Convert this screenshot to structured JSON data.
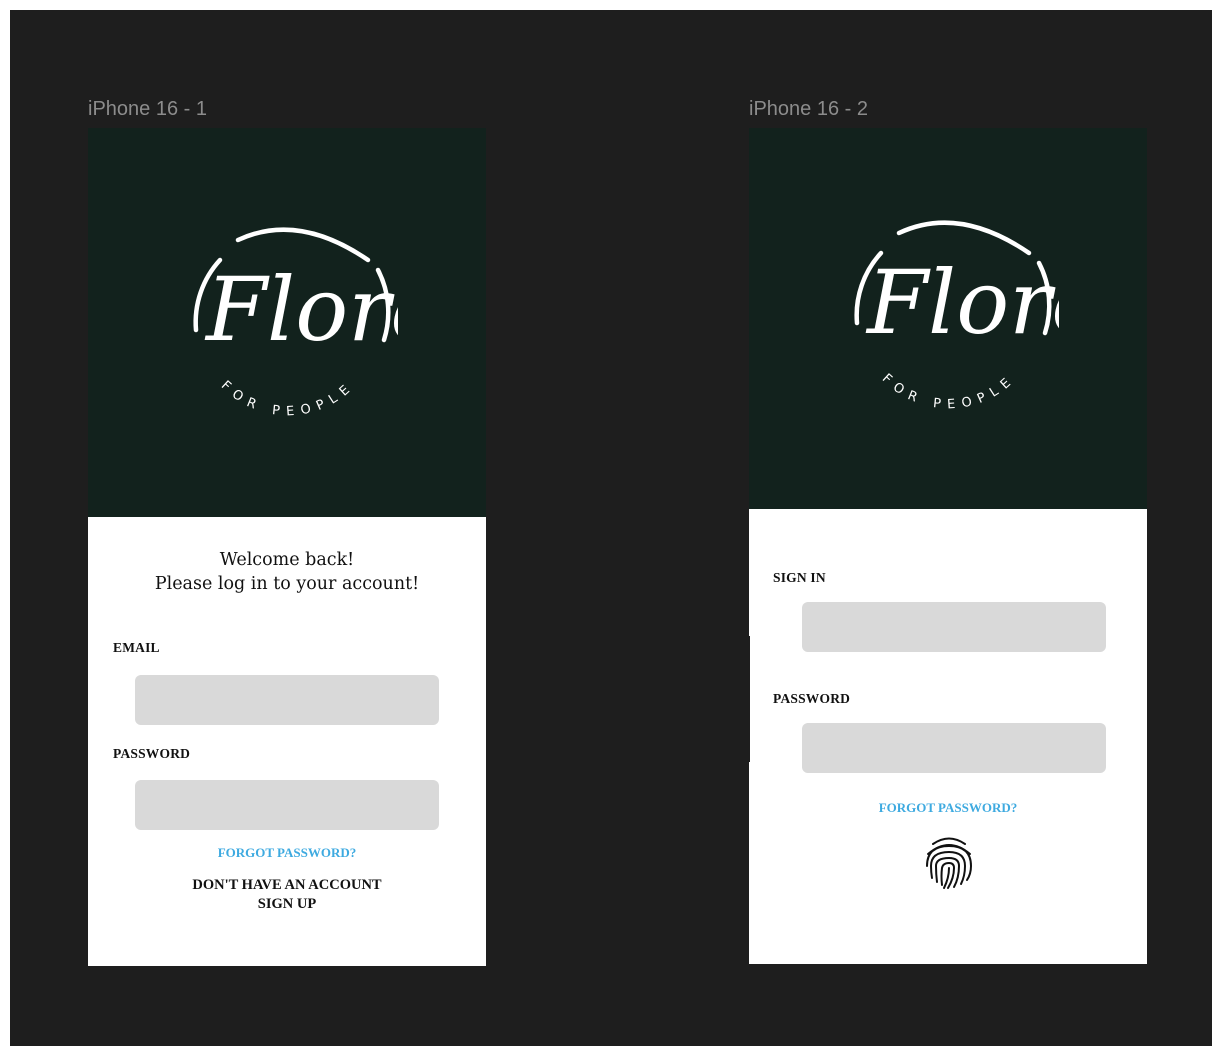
{
  "frames": [
    {
      "label": "iPhone 16 - 1",
      "logo": {
        "word": "Flore",
        "tagline": "FOR PEOPLE"
      },
      "welcome_line1": "Welcome back!",
      "welcome_line2": "Please log in to your account!",
      "email_label": "EMAIL",
      "email_value": "",
      "password_label": "PASSWORD",
      "password_value": "",
      "forgot_password": "FORGOT PASSWORD?",
      "signup_line1": "DON'T HAVE AN ACCOUNT",
      "signup_line2": "SIGN UP"
    },
    {
      "label": "iPhone 16 - 2",
      "logo": {
        "word": "Flore",
        "tagline": "FOR PEOPLE"
      },
      "signin_label": "SIGN IN",
      "signin_value": "",
      "password_label": "PASSWORD",
      "password_value": "",
      "forgot_password": "FORGOT PASSWORD?",
      "fingerprint_icon": "fingerprint-icon"
    }
  ],
  "colors": {
    "canvas": "#1e1e1e",
    "hero": "#12221d",
    "input": "#d9d9d9",
    "link": "#3eaae0"
  }
}
